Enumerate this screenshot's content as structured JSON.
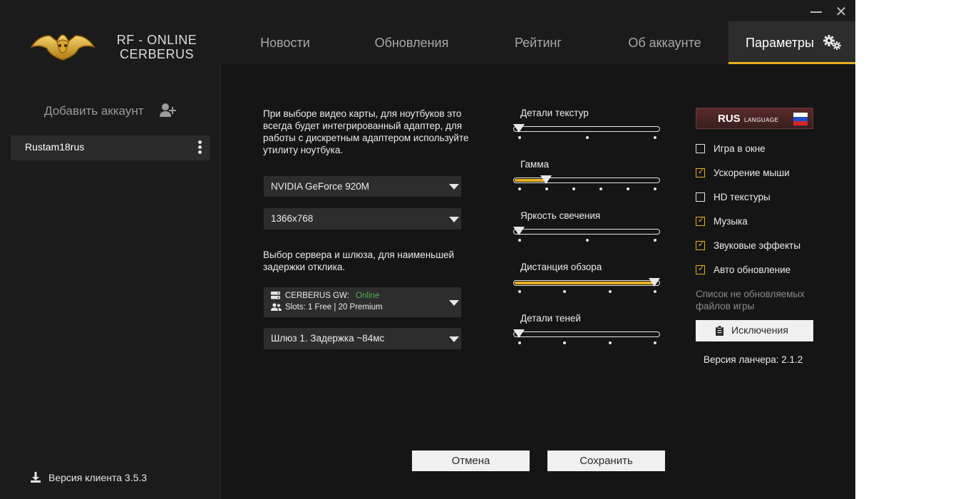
{
  "window": {
    "minimize_glyph": "",
    "close_glyph": "✕"
  },
  "logo": {
    "text_line1": "RF - ONLINE",
    "text_line2": "CERBERUS"
  },
  "tabs": [
    {
      "label": "Новости"
    },
    {
      "label": "Обновления"
    },
    {
      "label": "Рейтинг"
    },
    {
      "label": "Об аккаунте"
    },
    {
      "label": "Параметры",
      "active": true
    }
  ],
  "sidebar": {
    "add_account_label": "Добавить аккаунт",
    "accounts": [
      {
        "name": "Rustam18rus"
      }
    ],
    "client_version": "Версия клиента 3.5.3"
  },
  "settings": {
    "gpu_note": "При выборе видео карты, для ноутбуков это всегда будет интегрированный адаптер, для работы с дискретным адаптером используйте утилиту ноутбука.",
    "gpu": "NVIDIA GeForce 920M",
    "resolution": "1366x768",
    "server_note": "Выбор сервера и шлюза, для наименьшей задержки отклика.",
    "server": {
      "name": "CERBERUS GW:",
      "status": "Online",
      "slots": "Slots: 1 Free | 20 Premium"
    },
    "gateway": "Шлюз 1. Задержка ~84мс",
    "sliders": [
      {
        "label": "Детали текстур",
        "steps": 3,
        "value_index": 0
      },
      {
        "label": "Гамма",
        "steps": 6,
        "value_index": 1
      },
      {
        "label": "Яркость свечения",
        "steps": 3,
        "value_index": 0
      },
      {
        "label": "Дистанция обзора",
        "steps": 4,
        "value_index": 3
      },
      {
        "label": "Детали теней",
        "steps": 4,
        "value_index": 0
      }
    ],
    "language": {
      "code": "RUS",
      "word": "LANGUAGE"
    },
    "checkboxes": [
      {
        "label": "Игра в окне",
        "checked": false
      },
      {
        "label": "Ускорение мыши",
        "checked": true
      },
      {
        "label": "HD текстуры",
        "checked": false
      },
      {
        "label": "Музыка",
        "checked": true
      },
      {
        "label": "Звуковые эффекты",
        "checked": true
      },
      {
        "label": "Авто обновление",
        "checked": true
      }
    ],
    "exclusions_note": "Список не обновляемых файлов игры",
    "exclusions_button": "Исключения",
    "launcher_version": "Версия ланчера: 2.1.2",
    "cancel_button": "Отмена",
    "save_button": "Сохранить"
  },
  "colors": {
    "accent": "#e8b020",
    "online": "#4caf50",
    "background": "#1b1b1b"
  }
}
